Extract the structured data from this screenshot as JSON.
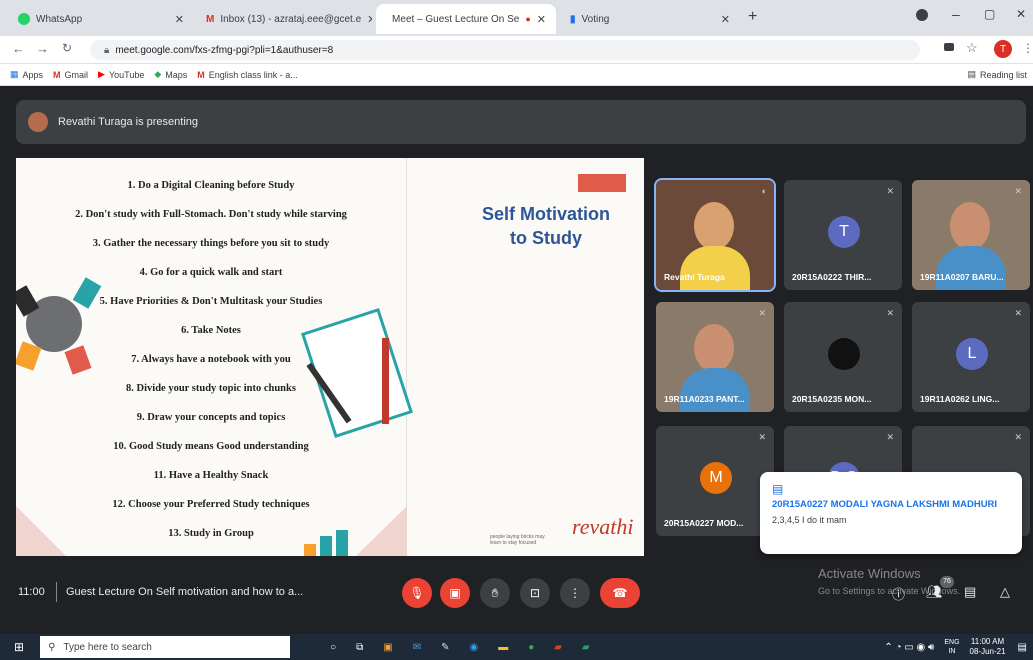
{
  "tabs": [
    {
      "title": "WhatsApp",
      "color": "#25d366"
    },
    {
      "title": "Inbox (13) - azrataj.eee@gcet.e",
      "color": "#d93025"
    },
    {
      "title": "Meet – Guest Lecture On Se",
      "color": "#00897b"
    },
    {
      "title": "Voting",
      "color": "#5f6368"
    }
  ],
  "address": {
    "url": "meet.google.com/fxs-zfmg-pgi?pli=1&authuser=8",
    "profile": "T"
  },
  "bookmarks": [
    "Apps",
    "Gmail",
    "YouTube",
    "Maps",
    "English class link - a..."
  ],
  "reading_list": "Reading list",
  "presenting": "Revathi Turaga is presenting",
  "slide": {
    "title_line1": "Self Motivation",
    "title_line2": "to Study",
    "tips": [
      "1. Do a Digital Cleaning before Study",
      "2. Don't study with Full-Stomach. Don't study while starving",
      "3. Gather the necessary things before you sit to study",
      "4. Go for a quick walk and start",
      "5. Have Priorities & Don't Multitask your Studies",
      "6. Take Notes",
      "7. Always have a notebook with you",
      "8. Divide your study topic into chunks",
      "9. Draw your concepts and topics",
      "10. Good Study means Good understanding",
      "11. Have a Healthy Snack",
      "12. Choose your Preferred Study techniques",
      "13. Study in Group"
    ],
    "brand": "revathi",
    "tagline": "people laying bricks may\nlearn to stay focused"
  },
  "participants": [
    {
      "name": "Revathi Turaga",
      "type": "video"
    },
    {
      "name": "20R15A0222 THIR...",
      "initial": "T",
      "color": "#5c6bc0"
    },
    {
      "name": "19R11A0207 BARU...",
      "type": "video"
    },
    {
      "name": "19R11A0233 PANT...",
      "type": "video"
    },
    {
      "name": "20R15A0235 MON...",
      "initial": "",
      "color": "#111111"
    },
    {
      "name": "19R11A0262 LING...",
      "initial": "L",
      "color": "#5c6bc0"
    },
    {
      "name": "20R15A0227 MOD...",
      "initial": "M",
      "color": "#e8710a"
    },
    {
      "name": "",
      "initial": "B G",
      "color": "#5c6bc0"
    },
    {
      "name": "",
      "initial": "",
      "color": "#3c4043"
    }
  ],
  "chat": {
    "sender": "20R15A0227 MODALI YAGNA LAKSHMI MADHURI",
    "message": "2,3,4,5 I do it mam"
  },
  "controls": {
    "time": "11:00",
    "meeting": "Guest Lecture On Self motivation and how to a...",
    "people_count": "76"
  },
  "watermark": {
    "line1": "Activate Windows",
    "line2": "Go to Settings to activate Windows."
  },
  "taskbar": {
    "search": "Type here to search",
    "lang": "ENG",
    "region": "IN",
    "time": "11:00 AM",
    "date": "08-Jun-21"
  }
}
